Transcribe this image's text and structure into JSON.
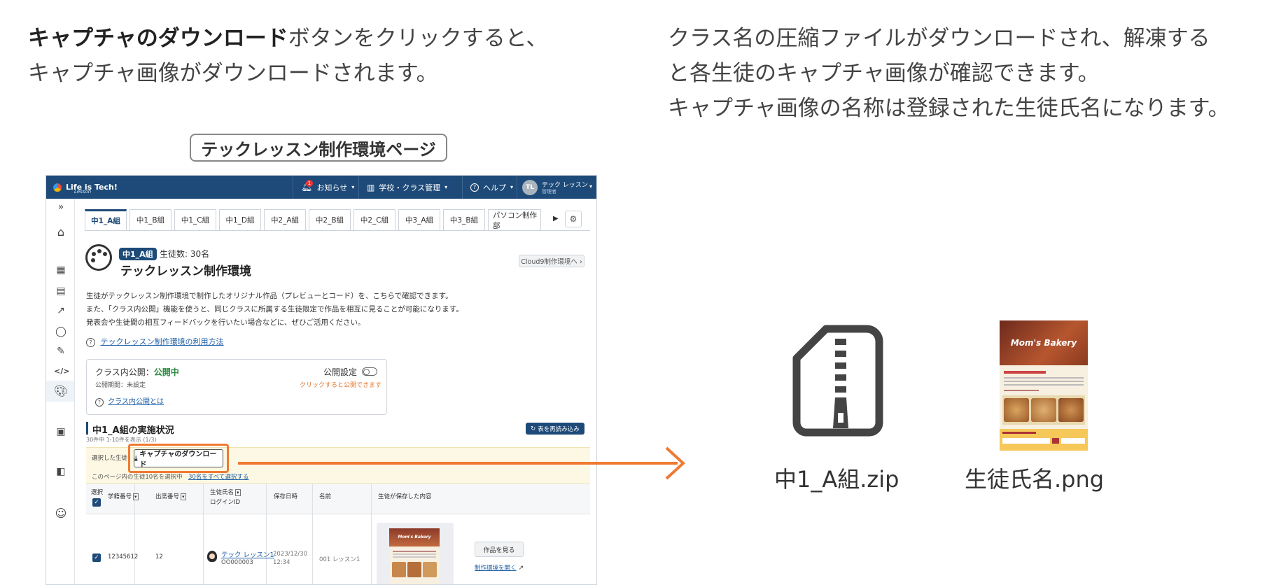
{
  "instruction_left": {
    "bold": "キャプチャのダウンロード",
    "line1_rest": "ボタンをクリックすると、",
    "line2": "キャプチャ画像がダウンロードされます。"
  },
  "instruction_right": {
    "line1": "クラス名の圧縮ファイルがダウンロードされ、解凍する",
    "line2": "と各生徒のキャプチャ画像が確認できます。",
    "line3": "キャプチャ画像の名称は登録された生徒氏名になります。"
  },
  "page_label": "テックレッスン制作環境ページ",
  "app": {
    "logo": "Life is Tech!",
    "logo_sub": "Lesson",
    "notice": "お知らせ",
    "notice_count": "1",
    "school": "学校・クラス管理",
    "help": "ヘルプ",
    "avatar": "TL",
    "user_name": "テック レッスン",
    "user_role": "管理者"
  },
  "sidebar_expand": "»",
  "tabs": [
    "中1_A組",
    "中1_B組",
    "中1_C組",
    "中1_D組",
    "中2_A組",
    "中2_B組",
    "中2_C組",
    "中3_A組",
    "中3_B組",
    "パソコン制作部"
  ],
  "header": {
    "class_badge": "中1_A組",
    "student_count": "生徒数: 30名",
    "title": "テックレッスン制作環境",
    "cloud9": "Cloud9制作環境へ ›"
  },
  "description": {
    "line1": "生徒がテックレッスン制作環境で制作したオリジナル作品（プレビューとコード）を、こちらで確認できます。",
    "line2": "また、「クラス内公開」機能を使うと、同じクラスに所属する生徒限定で作品を相互に見ることが可能になります。",
    "line3": "発表会や生徒間の相互フィードバックを行いたい場合などに、ぜひご活用ください。",
    "howto": "テックレッスン制作環境の利用方法"
  },
  "publish": {
    "label": "クラス内公開：",
    "status": "公開中",
    "period": "公開期間：未設定",
    "setting": "公開設定",
    "hint": "クリックすると公開できます",
    "what": "クラス内公開とは"
  },
  "progress": {
    "title": "中1_A組の実施状況",
    "count": "30件中 1-10件を表示 (1/3)",
    "reload": "表を再読み込み"
  },
  "selection": {
    "prefix": "選択した生徒の",
    "download": "キャプチャのダウンロード",
    "selected": "このページ内の生徒10名を選択中",
    "select_all": "30名をすべて選択する"
  },
  "table": {
    "headers": {
      "select": "選択",
      "student_no": "学籍番号",
      "seat_no": "出席番号",
      "name": "生徒氏名",
      "login": "ログインID",
      "saved": "保存日時",
      "work_name": "名前",
      "content": "生徒が保存した内容"
    },
    "row": {
      "student_no": "12345612",
      "seat_no": "12",
      "name": "テック レッスン1",
      "login": "OO000003",
      "date": "2023/12/30",
      "time": "12:34",
      "work_name": "001 レッスン1",
      "view": "作品を見る",
      "open_env": "制作環境を開く"
    }
  },
  "thumb_title": "Mom's Bakery",
  "result": {
    "zip": "中1_A組.zip",
    "png": "生徒氏名.png"
  }
}
